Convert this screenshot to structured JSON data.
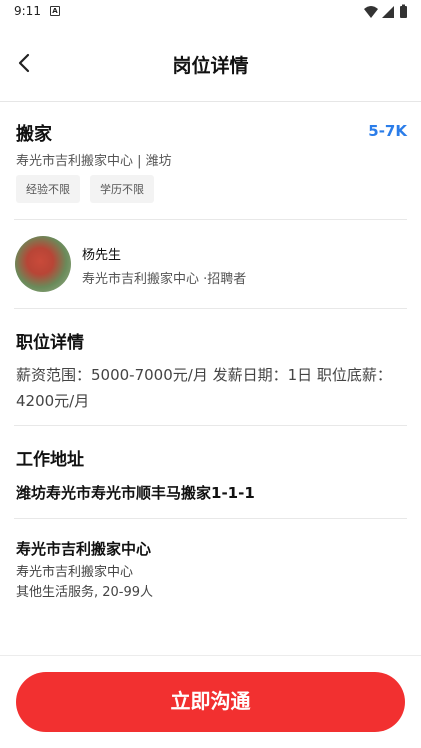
{
  "status_bar": {
    "time": "9:11",
    "notification_icon": "A"
  },
  "header": {
    "title": "岗位详情"
  },
  "job": {
    "title": "搬家",
    "salary": "5-7K",
    "company_city": "寿光市吉利搬家中心 | 潍坊",
    "tags": [
      "经验不限",
      "学历不限"
    ]
  },
  "recruiter": {
    "name": "杨先生",
    "role": "寿光市吉利搬家中心 ·招聘者"
  },
  "details": {
    "heading": "职位详情",
    "text": "薪资范围：5000-7000元/月 发薪日期：1日 职位底薪：4200元/月"
  },
  "address": {
    "heading": "工作地址",
    "text": "潍坊寿光市寿光市顺丰马搬家1-1-1"
  },
  "company": {
    "name": "寿光市吉利搬家中心",
    "subname": "寿光市吉利搬家中心",
    "info": "其他生活服务, 20-99人"
  },
  "actions": {
    "chat_label": "立即沟通"
  },
  "colors": {
    "accent": "#f23030",
    "salary": "#2b7de9"
  }
}
